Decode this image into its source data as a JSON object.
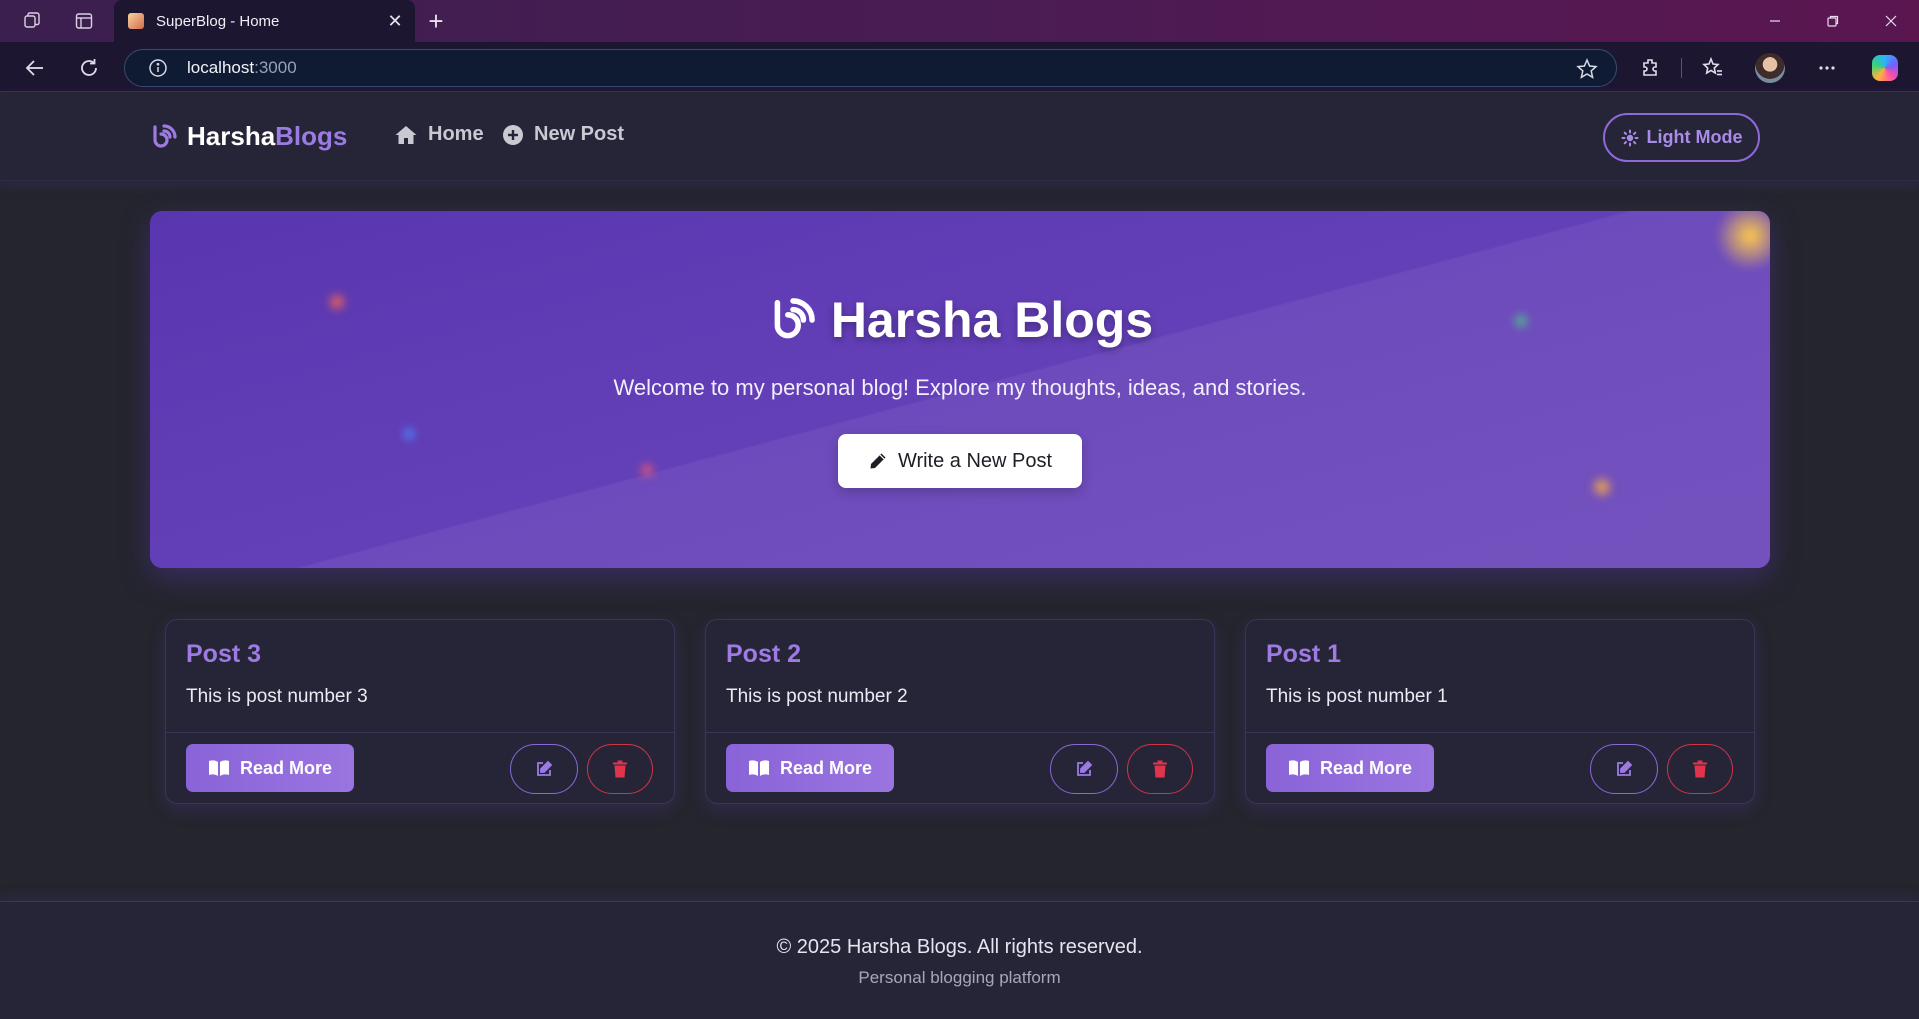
{
  "browser": {
    "tab_title": "SuperBlog - Home",
    "url_host": "localhost",
    "url_port": ":3000"
  },
  "navbar": {
    "brand_first": "Harsha",
    "brand_second": "Blogs",
    "home_label": "Home",
    "new_post_label": "New Post",
    "theme_toggle_label": "Light Mode"
  },
  "hero": {
    "title": "Harsha Blogs",
    "subtitle": "Welcome to my personal blog! Explore my thoughts, ideas, and stories.",
    "cta_label": "Write a New Post"
  },
  "posts": [
    {
      "title": "Post 3",
      "body": "This is post number 3",
      "read_label": "Read More"
    },
    {
      "title": "Post 2",
      "body": "This is post number 2",
      "read_label": "Read More"
    },
    {
      "title": "Post 1",
      "body": "This is post number 1",
      "read_label": "Read More"
    }
  ],
  "footer": {
    "copyright": "© 2025 Harsha Blogs. All rights reserved.",
    "tagline": "Personal blogging platform"
  },
  "colors": {
    "accent": "#9b7be2",
    "hero_bg": "#6440b8",
    "danger": "#e0344c",
    "page_bg": "#24252d"
  },
  "icons": {
    "brand": "blog-icon",
    "home": "home-icon",
    "new_post": "plus-circle-icon",
    "theme": "sun-icon",
    "write": "pencil-icon",
    "read": "book-icon",
    "edit": "edit-icon",
    "delete": "trash-icon"
  }
}
